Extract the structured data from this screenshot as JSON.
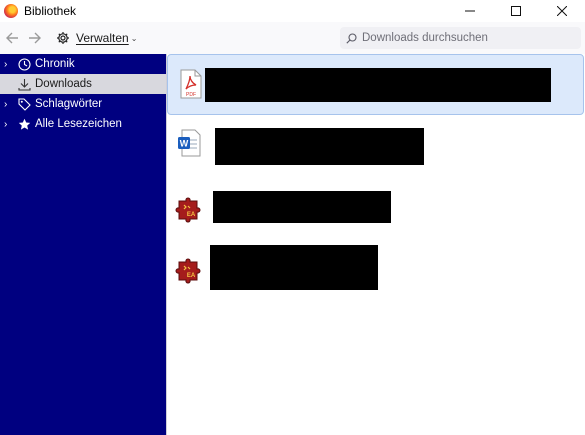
{
  "window": {
    "title": "Bibliothek",
    "controls": [
      "minimize",
      "maximize",
      "close"
    ]
  },
  "toolbar": {
    "back_icon": "arrow-left-icon",
    "forward_icon": "arrow-right-icon",
    "organize_label": "Verwalten",
    "search_placeholder": "Downloads durchsuchen"
  },
  "sidebar": {
    "items": [
      {
        "label": "Chronik",
        "icon": "clock-icon",
        "expandable": true,
        "selected": false
      },
      {
        "label": "Downloads",
        "icon": "download-icon",
        "expandable": false,
        "selected": true
      },
      {
        "label": "Schlagwörter",
        "icon": "tags-icon",
        "expandable": true,
        "selected": false
      },
      {
        "label": "Alle Lesezeichen",
        "icon": "star-icon",
        "expandable": true,
        "selected": false
      }
    ]
  },
  "downloads": {
    "items": [
      {
        "type": "pdf",
        "icon": "pdf-file-icon",
        "icon_label": "PDF",
        "name_redacted": true,
        "selected": true
      },
      {
        "type": "word",
        "icon": "word-file-icon",
        "icon_label": "W",
        "name_redacted": true,
        "selected": false
      },
      {
        "type": "app",
        "icon": "puzzle-app-icon",
        "icon_label": "EA",
        "name_redacted": true,
        "selected": false
      },
      {
        "type": "app",
        "icon": "puzzle-app-icon",
        "icon_label": "EA",
        "name_redacted": true,
        "selected": false
      }
    ]
  },
  "colors": {
    "sidebar_bg": "#000080",
    "selected_sidebar_row": "#d8d8de",
    "selected_download": "#dce9fb",
    "redaction": "#000000"
  }
}
